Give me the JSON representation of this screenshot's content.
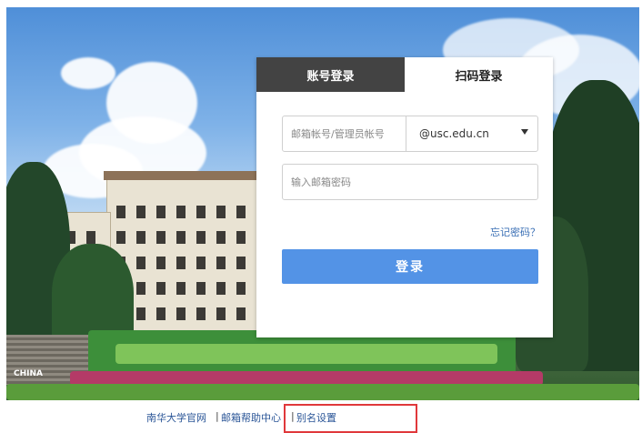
{
  "tabs": [
    {
      "label": "账号登录",
      "active": false
    },
    {
      "label": "扫码登录",
      "active": true
    }
  ],
  "account": {
    "placeholder": "邮箱帐号/管理员帐号",
    "value": ""
  },
  "domain": {
    "selected": "@usc.edu.cn"
  },
  "password": {
    "placeholder": "输入邮箱密码",
    "value": ""
  },
  "forgot_label": "忘记密码？",
  "login_label": "登录",
  "footer": {
    "links": [
      "南华大学官网",
      "邮箱帮助中心",
      "别名设置"
    ],
    "separator": "|"
  },
  "photo": {
    "caption": "CHINA"
  },
  "colors": {
    "primary_button": "#5393e6",
    "tab_inactive": "#434343",
    "link": "#3a6fb5",
    "highlight": "#e0383b"
  }
}
